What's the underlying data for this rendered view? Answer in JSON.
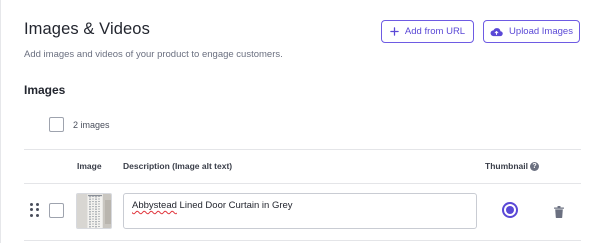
{
  "header": {
    "title": "Images & Videos",
    "subtitle": "Add images and videos of your product to engage customers."
  },
  "actions": {
    "add_from_url": "Add from URL",
    "upload_images": "Upload Images"
  },
  "images_section": {
    "title": "Images",
    "count_label": "2 images"
  },
  "table": {
    "columns": {
      "image": "Image",
      "description": "Description (Image alt text)",
      "thumbnail": "Thumbnail"
    },
    "rows": [
      {
        "description_first_word": "Abbystead",
        "description_rest": " Lined Door Curtain in Grey",
        "is_thumbnail": true
      }
    ]
  },
  "colors": {
    "accent": "#5a48d6",
    "border": "#e4e5e8",
    "text": "#23262f"
  }
}
